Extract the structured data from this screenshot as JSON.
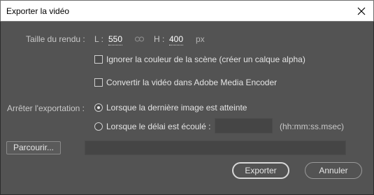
{
  "window": {
    "title": "Exporter la vidéo"
  },
  "render_size": {
    "label": "Taille du rendu :",
    "width_label": "L :",
    "width_value": "550",
    "height_label": "H :",
    "height_value": "400",
    "unit": "px"
  },
  "options": {
    "ignore_stage_color": {
      "label": "Ignorer la couleur de la scène (créer un calque alpha)",
      "checked": false
    },
    "convert_ame": {
      "label": "Convertir la vidéo dans Adobe Media Encoder",
      "checked": false
    }
  },
  "stop_export": {
    "label": "Arrêter l'exportation :",
    "option_last_frame": "Lorsque la dernière image est atteinte",
    "option_delay": "Lorsque le délai est écoulé :",
    "time_format": "(hh:mm:ss.msec)",
    "delay_value": "",
    "selected": "last_frame"
  },
  "path": {
    "browse_label": "Parcourir...",
    "value": ""
  },
  "buttons": {
    "export_label": "Exporter",
    "cancel_label": "Annuler"
  },
  "icons": [
    "close-icon",
    "link-icon"
  ]
}
